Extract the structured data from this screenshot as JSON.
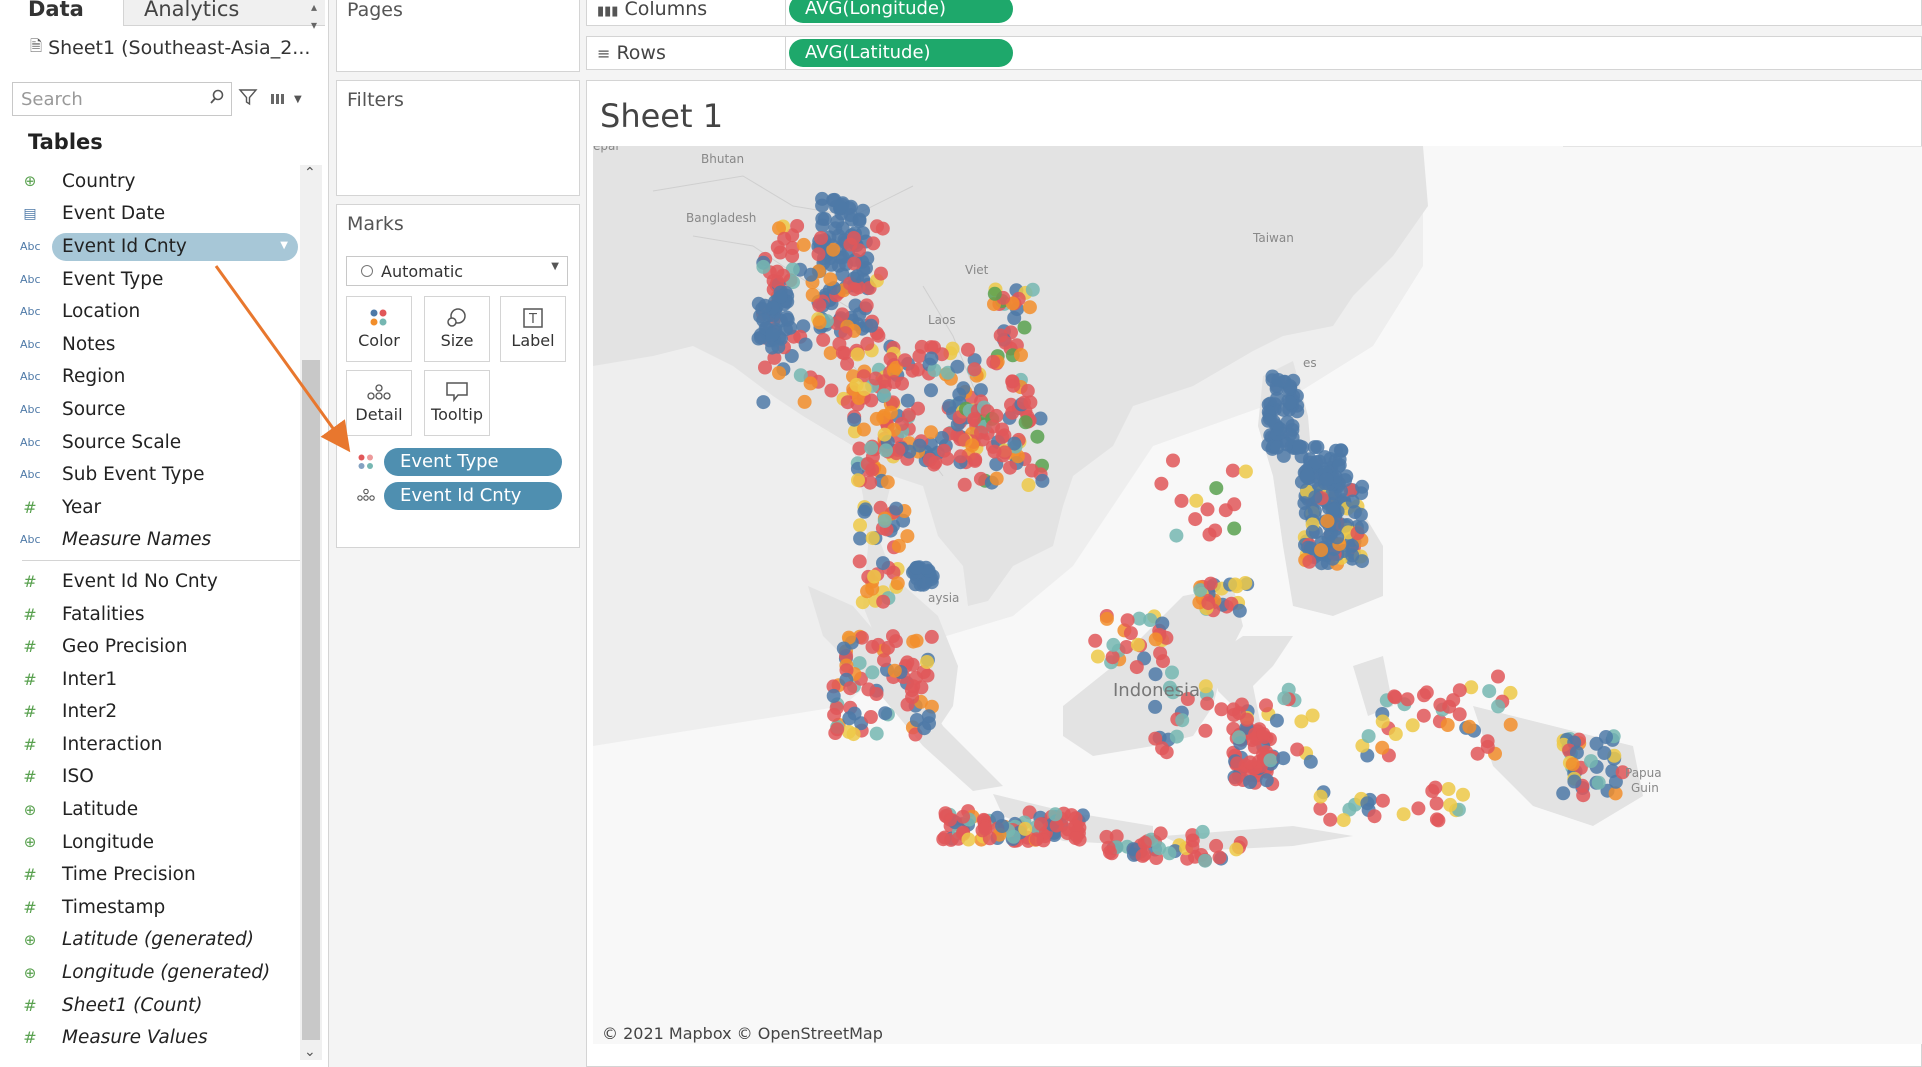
{
  "tabs": {
    "data": "Data",
    "analytics": "Analytics"
  },
  "datasource": "Sheet1 (Southeast-Asia_2...",
  "search": {
    "placeholder": "Search"
  },
  "tables_heading": "Tables",
  "dimensions": [
    {
      "label": "Country",
      "icon": "globe-icon",
      "italic": false
    },
    {
      "label": "Event Date",
      "icon": "calendar-icon",
      "italic": false
    },
    {
      "label": "Event Id Cnty",
      "icon": "abc-icon",
      "italic": false,
      "selected": true
    },
    {
      "label": "Event Type",
      "icon": "abc-icon",
      "italic": false
    },
    {
      "label": "Location",
      "icon": "abc-icon",
      "italic": false
    },
    {
      "label": "Notes",
      "icon": "abc-icon",
      "italic": false
    },
    {
      "label": "Region",
      "icon": "abc-icon",
      "italic": false
    },
    {
      "label": "Source",
      "icon": "abc-icon",
      "italic": false
    },
    {
      "label": "Source Scale",
      "icon": "abc-icon",
      "italic": false
    },
    {
      "label": "Sub Event Type",
      "icon": "abc-icon",
      "italic": false
    },
    {
      "label": "Year",
      "icon": "hash-icon",
      "italic": false
    },
    {
      "label": "Measure Names",
      "icon": "abc-icon",
      "italic": true
    }
  ],
  "measures": [
    {
      "label": "Event Id No Cnty",
      "icon": "hash-icon",
      "italic": false
    },
    {
      "label": "Fatalities",
      "icon": "hash-icon",
      "italic": false
    },
    {
      "label": "Geo Precision",
      "icon": "hash-icon",
      "italic": false
    },
    {
      "label": "Inter1",
      "icon": "hash-icon",
      "italic": false
    },
    {
      "label": "Inter2",
      "icon": "hash-icon",
      "italic": false
    },
    {
      "label": "Interaction",
      "icon": "hash-icon",
      "italic": false
    },
    {
      "label": "ISO",
      "icon": "hash-icon",
      "italic": false
    },
    {
      "label": "Latitude",
      "icon": "globe-icon",
      "italic": false
    },
    {
      "label": "Longitude",
      "icon": "globe-icon",
      "italic": false
    },
    {
      "label": "Time Precision",
      "icon": "hash-icon",
      "italic": false
    },
    {
      "label": "Timestamp",
      "icon": "hash-icon",
      "italic": false
    },
    {
      "label": "Latitude (generated)",
      "icon": "globe-icon",
      "italic": true
    },
    {
      "label": "Longitude (generated)",
      "icon": "globe-icon",
      "italic": true
    },
    {
      "label": "Sheet1 (Count)",
      "icon": "hash-icon",
      "italic": true
    },
    {
      "label": "Measure Values",
      "icon": "hash-icon",
      "italic": true
    }
  ],
  "cards": {
    "pages": "Pages",
    "filters": "Filters",
    "marks": "Marks"
  },
  "marks": {
    "type": "Automatic",
    "buttons": {
      "color": "Color",
      "size": "Size",
      "label": "Label",
      "detail": "Detail",
      "tooltip": "Tooltip"
    },
    "fields": [
      {
        "label": "Event Type",
        "encoding": "color"
      },
      {
        "label": "Event Id Cnty",
        "encoding": "detail"
      }
    ]
  },
  "shelves": {
    "columns": {
      "label": "Columns",
      "pill": "AVG(Longitude)"
    },
    "rows": {
      "label": "Rows",
      "pill": "AVG(Latitude)"
    }
  },
  "sheet_title": "Sheet 1",
  "map": {
    "labels": [
      "epal",
      "Bhutan",
      "Bangladesh",
      "Taiwan",
      "Indonesia",
      "aysia",
      "Papua",
      "Guin",
      "Laos",
      "Viet",
      "es"
    ],
    "credit": "© 2021 Mapbox © OpenStreetMap"
  },
  "colors": {
    "accent_pill": "#4f8fb0",
    "green_pill": "#1ea86b",
    "selected_field": "#a7c7d7",
    "arrow": "#e8772e",
    "event_colors": [
      "#e15759",
      "#4e79a7",
      "#f28e2b",
      "#edc948",
      "#76b7b2",
      "#59a14f"
    ]
  }
}
